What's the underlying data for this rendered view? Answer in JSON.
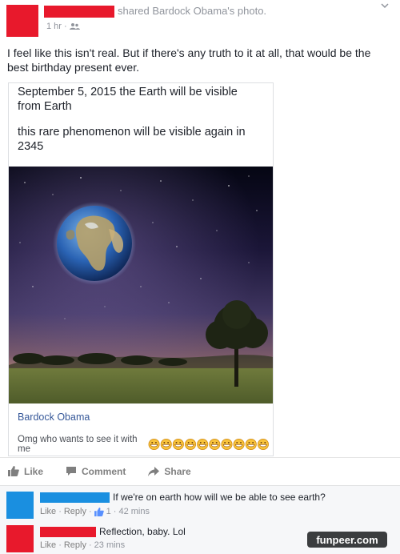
{
  "post": {
    "shared_text": "shared Bardock Obama's photo.",
    "time": "1 hr",
    "audience_icon": "friends-icon",
    "chevron_icon": "chevron-down-icon",
    "text": "I feel like this isn't real. But if there's any truth to it at all, that would be the best birthday present ever.",
    "colors": {
      "redaction": "#e8192c",
      "link": "#365899",
      "meta": "#90949c"
    }
  },
  "shared_photo": {
    "line1": "September 5, 2015 the Earth will be visible from Earth",
    "line2": "this rare phenomenon will be visible again in 2345",
    "owner_name": "Bardock Obama",
    "caption": "Omg who wants to see it with me",
    "emoji_icon": "grin-emoji-icon",
    "emoji_count": 10
  },
  "actions": {
    "like": "Like",
    "comment": "Comment",
    "share": "Share",
    "like_icon": "thumbs-up-icon",
    "comment_icon": "comment-icon",
    "share_icon": "share-arrow-icon"
  },
  "comments": [
    {
      "avatar_color": "#1a8fe0",
      "text": "If we're on earth how will we be able to see earth?",
      "like": "Like",
      "reply": "Reply",
      "likes": "1",
      "time": "42 mins"
    },
    {
      "avatar_color": "#e8192c",
      "text": "Reflection, baby. Lol",
      "like": "Like",
      "reply": "Reply",
      "time": "23 mins"
    }
  ],
  "watermark": "funpeer.com"
}
